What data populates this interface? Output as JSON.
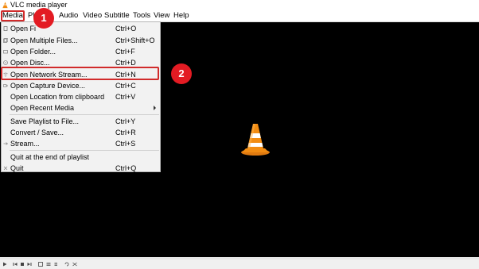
{
  "window": {
    "title": "VLC media player"
  },
  "menubar": {
    "items": [
      "Media",
      "Playback",
      "Audio",
      "Video",
      "Subtitle",
      "Tools",
      "View",
      "Help"
    ],
    "visible_labels": {
      "media": "Media",
      "playback_partial": "Pl",
      "audio": "Audio",
      "video": "Video",
      "subtitle": "Subtitle",
      "tools": "Tools",
      "view": "View",
      "help": "Help"
    }
  },
  "media_menu": {
    "items": [
      {
        "label": "Open File...",
        "visible": "Open Fi",
        "shortcut": "Ctrl+O"
      },
      {
        "label": "Open Multiple Files...",
        "shortcut": "Ctrl+Shift+O"
      },
      {
        "label": "Open Folder...",
        "shortcut": "Ctrl+F"
      },
      {
        "label": "Open Disc...",
        "shortcut": "Ctrl+D"
      },
      {
        "label": "Open Network Stream...",
        "shortcut": "Ctrl+N"
      },
      {
        "label": "Open Capture Device...",
        "shortcut": "Ctrl+C"
      },
      {
        "label": "Open Location from clipboard",
        "shortcut": "Ctrl+V"
      },
      {
        "label": "Open Recent Media",
        "shortcut": ""
      },
      {
        "label": "Save Playlist to File...",
        "shortcut": "Ctrl+Y"
      },
      {
        "label": "Convert / Save...",
        "shortcut": "Ctrl+R"
      },
      {
        "label": "Stream...",
        "shortcut": "Ctrl+S"
      },
      {
        "label": "Quit at the end of playlist",
        "shortcut": ""
      },
      {
        "label": "Quit",
        "shortcut": "Ctrl+Q"
      }
    ]
  },
  "annotations": {
    "step1": "1",
    "step2": "2",
    "color": "#e31b23"
  },
  "colors": {
    "highlight_border": "#d12b2b",
    "video_bg": "#000000",
    "cone_orange": "#f28c12"
  }
}
